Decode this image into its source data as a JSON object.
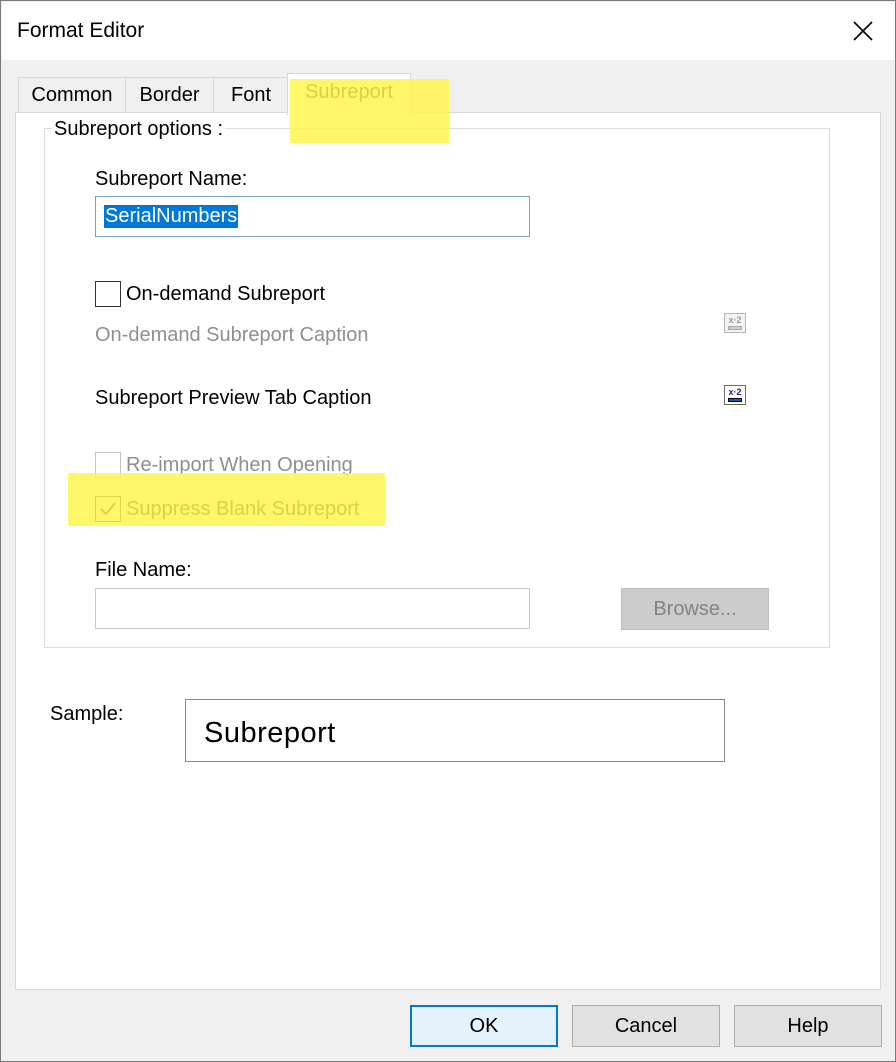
{
  "window": {
    "title": "Format Editor"
  },
  "tabs": [
    {
      "label": "Common"
    },
    {
      "label": "Border"
    },
    {
      "label": "Font"
    },
    {
      "label": "Subreport"
    }
  ],
  "group": {
    "label": "Subreport options :"
  },
  "subreport_name": {
    "label": "Subreport Name:",
    "value": "SerialNumbers"
  },
  "on_demand": {
    "label": "On-demand Subreport",
    "checked": false
  },
  "on_demand_caption": {
    "label": "On-demand Subreport Caption"
  },
  "preview_tab_caption": {
    "label": "Subreport Preview Tab Caption"
  },
  "reimport": {
    "label": "Re-import When Opening",
    "checked": false,
    "enabled": false
  },
  "suppress_blank": {
    "label": "Suppress Blank Subreport",
    "checked": true
  },
  "file_name": {
    "label": "File Name:",
    "value": ""
  },
  "browse_button": {
    "label": "Browse..."
  },
  "sample": {
    "label": "Sample:",
    "text": "Subreport"
  },
  "buttons": {
    "ok": "OK",
    "cancel": "Cancel",
    "help": "Help"
  },
  "icons": {
    "close": "close-icon",
    "formula": "formula-button-icon",
    "check": "checkmark-icon"
  },
  "colors": {
    "highlight": "#fff64f",
    "selection": "#0078d7",
    "default_button_border": "#0078d7"
  }
}
